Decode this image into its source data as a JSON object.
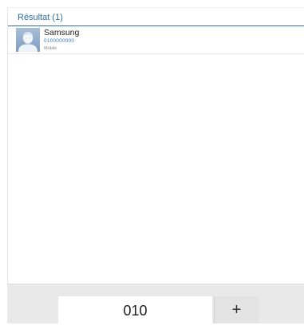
{
  "results": {
    "header": "Résultat (1)",
    "items": [
      {
        "name": "Samsung",
        "number": "0100000000",
        "type": "Mobile",
        "avatar": "person-placeholder-icon"
      }
    ]
  },
  "dialer": {
    "input_value": "010",
    "add_label": "+"
  },
  "colors": {
    "accent": "#2e6da4",
    "number_text": "#3a78c2",
    "avatar_bg": "#8fa9c7",
    "bottom_bar": "#e9e9e9"
  }
}
